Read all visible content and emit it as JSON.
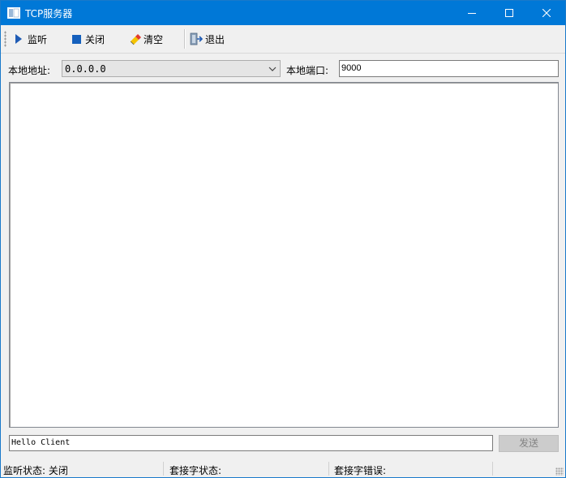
{
  "window": {
    "title": "TCP服务器",
    "controls": [
      "minimize-icon",
      "maximize-icon",
      "close-icon"
    ]
  },
  "toolbar": {
    "listen_label": "监听",
    "close_label": "关闭",
    "clear_label": "清空",
    "exit_label": "退出"
  },
  "address": {
    "local_address_label": "本地地址:",
    "local_address_value": "0.0.0.0",
    "local_port_label": "本地端口:",
    "local_port_value": "9000"
  },
  "log": {
    "lines": []
  },
  "message": {
    "input_value": "Hello Client",
    "send_label": "发送"
  },
  "status": {
    "listen_status": "监听状态: 关闭",
    "socket_status": "套接字状态:",
    "socket_error": "套接字错误:"
  },
  "colors": {
    "titlebar": "#0078d7",
    "play_icon": "#1f5bb4",
    "stop_icon": "#1560bd"
  }
}
